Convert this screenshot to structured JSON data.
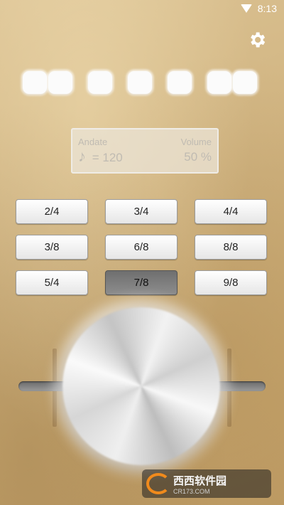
{
  "status_bar": {
    "time": "8:13",
    "wifi_icon": "wifi-icon"
  },
  "settings": {
    "icon": "gear-icon",
    "color": "#ffffff"
  },
  "beats": {
    "count": 8
  },
  "info": {
    "tempo_name": "Andate",
    "volume_label": "Volume",
    "note_symbol": "♪",
    "bpm_text": "= 120",
    "volume_value": "50 %"
  },
  "time_signatures": [
    {
      "label": "2/4",
      "selected": false
    },
    {
      "label": "3/4",
      "selected": false
    },
    {
      "label": "4/4",
      "selected": false
    },
    {
      "label": "3/8",
      "selected": false
    },
    {
      "label": "6/8",
      "selected": false
    },
    {
      "label": "8/8",
      "selected": false
    },
    {
      "label": "5/4",
      "selected": false
    },
    {
      "label": "7/8",
      "selected": true
    },
    {
      "label": "9/8",
      "selected": false
    }
  ],
  "watermark": {
    "brand": "西西软件园",
    "site": "CR173.COM"
  }
}
